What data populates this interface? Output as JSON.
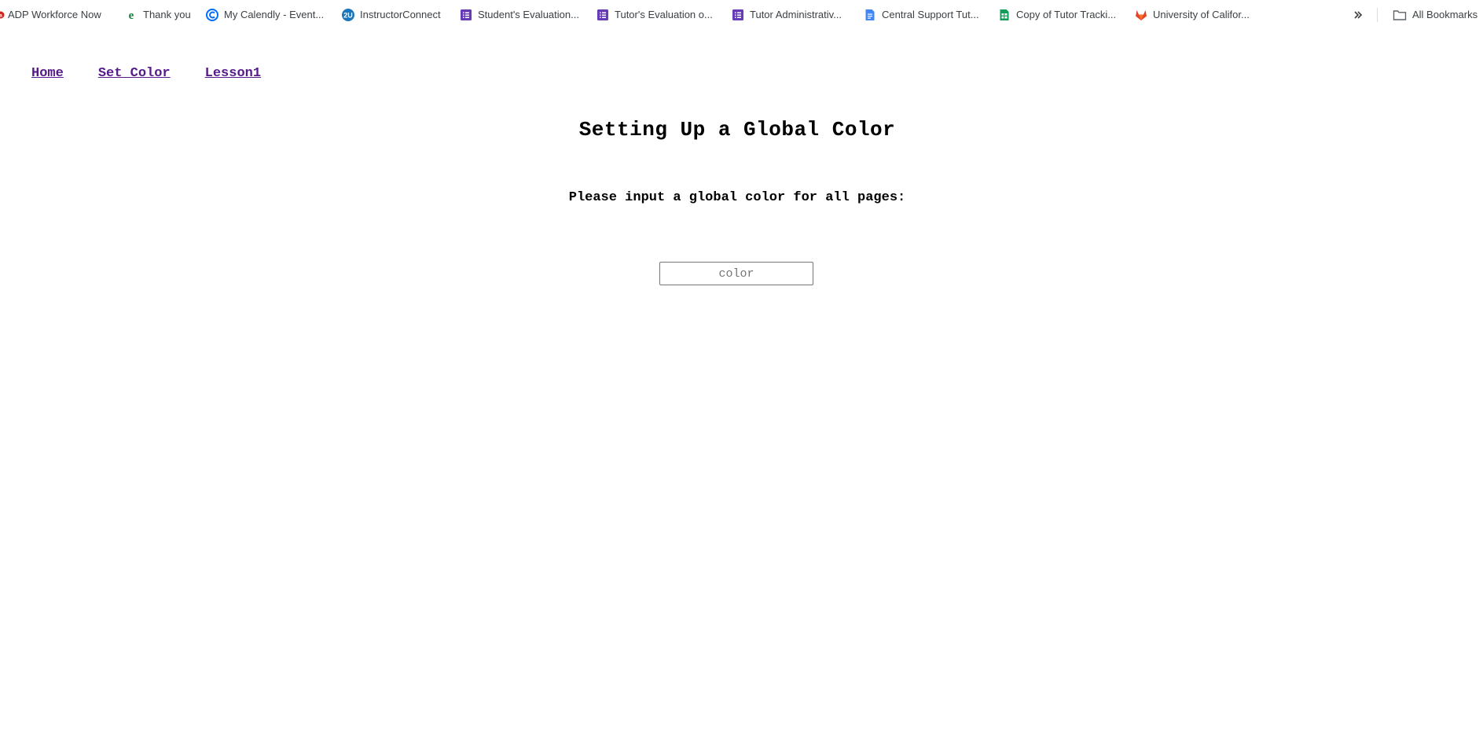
{
  "bookmarks": {
    "items": [
      {
        "label": "ADP Workforce Now",
        "icon": "adp-icon",
        "color": "#d0271d"
      },
      {
        "label": "Thank you",
        "icon": "e-logo-icon",
        "color": "#1b7a3e"
      },
      {
        "label": "My Calendly - Event...",
        "icon": "calendly-icon",
        "color": "#006bff"
      },
      {
        "label": "InstructorConnect",
        "icon": "2u-icon",
        "color": "#1b75bb"
      },
      {
        "label": "Student's Evaluation...",
        "icon": "google-forms-icon",
        "color": "#673ab7"
      },
      {
        "label": "Tutor's Evaluation o...",
        "icon": "google-forms-icon",
        "color": "#673ab7"
      },
      {
        "label": "Tutor Administrativ...",
        "icon": "google-forms-icon",
        "color": "#673ab7"
      },
      {
        "label": "Central Support Tut...",
        "icon": "google-docs-icon",
        "color": "#4285f4"
      },
      {
        "label": "Copy of Tutor Tracki...",
        "icon": "google-sheets-icon",
        "color": "#0f9d58"
      },
      {
        "label": "University of Califor...",
        "icon": "gitlab-icon",
        "color": "#e24329"
      }
    ],
    "all_bookmarks_label": "All Bookmarks"
  },
  "nav": {
    "home": "Home",
    "set_color": "Set Color",
    "lesson1": "Lesson1"
  },
  "main": {
    "title": "Setting Up a Global Color",
    "prompt": "Please input a global color for all pages:",
    "color_input": {
      "placeholder": "color",
      "value": ""
    }
  },
  "colors": {
    "link_visited": "#551a8b",
    "text": "#000000",
    "background": "#ffffff"
  }
}
